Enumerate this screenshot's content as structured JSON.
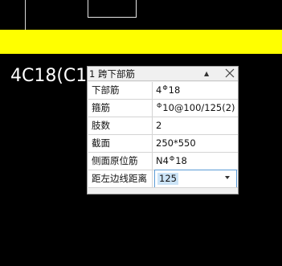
{
  "canvas": {
    "beam_annotation": "4C18(C1",
    "band_color": "#ffff00",
    "background_color": "#000000"
  },
  "panel": {
    "title": "1 跨下部筋",
    "collapse_icon": "caret-up-icon",
    "close_icon": "close-icon",
    "rows": [
      {
        "label": "下部筋",
        "value_parts": [
          "4",
          "18"
        ]
      },
      {
        "label": "箍筋",
        "value_parts": [
          "",
          "10@100/125(2)"
        ]
      },
      {
        "label": "肢数",
        "value": "2"
      },
      {
        "label": "截面",
        "value": "250*550"
      },
      {
        "label": "侧面原位筋",
        "value_parts": [
          "N4",
          "18"
        ]
      },
      {
        "label": "距左边线距离",
        "value": "125"
      }
    ],
    "rebar_symbol_icon": "rebar-grade-symbol-icon",
    "focus_color": "#5b9bd5",
    "selection_color": "#cce4f7"
  }
}
